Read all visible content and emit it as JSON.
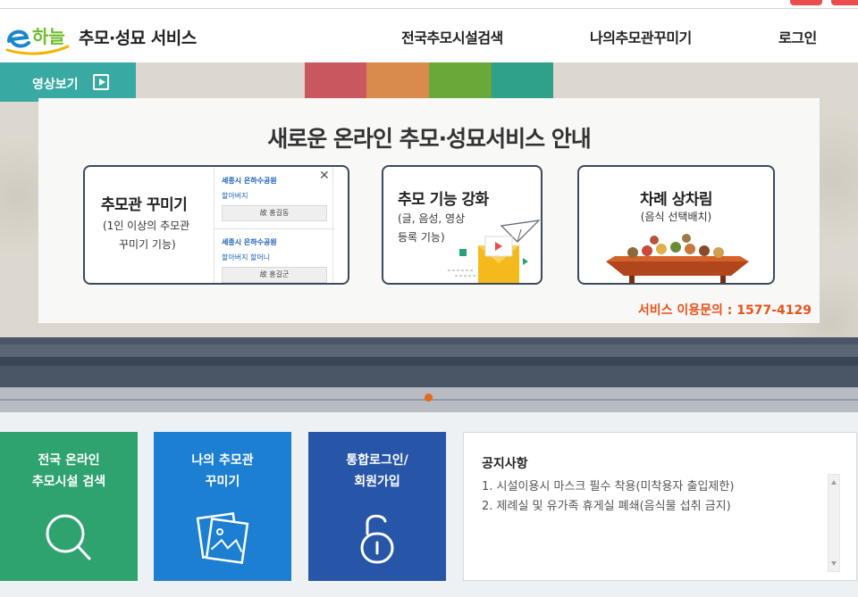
{
  "header": {
    "logo_text": "e하늘",
    "site_title": "추모·성묘 서비스",
    "nav": [
      "전국추모시설검색",
      "나의추모관꾸미기",
      "로그인"
    ]
  },
  "hero": {
    "video_button": "영상보기",
    "panel_title": "새로운 온라인 추모·성묘서비스 안내",
    "card1": {
      "title": "추모관 꾸미기",
      "desc_line1": "(1인 이상의 추모관",
      "desc_line2": "꾸미기 기능)",
      "mini_items": [
        {
          "place": "세종시 은하수공원",
          "relation": "할아버지",
          "name": "故 홍길동"
        },
        {
          "place": "세종시 은하수공원",
          "relation": "할아버지 할머니",
          "name": "故 홍길군"
        }
      ]
    },
    "card2": {
      "title": "추모 기능 강화",
      "desc_line1": "(글, 음성, 영상",
      "desc_line2": "등록 기능)"
    },
    "card3": {
      "title": "차례 상차림",
      "desc_line1": "(음식 선택배치)"
    },
    "contact": "서비스 이용문의 : 1577-4129"
  },
  "tiles": [
    {
      "line1": "전국 온라인",
      "line2": "추모시설 검색",
      "icon": "search-icon"
    },
    {
      "line1": "나의 추모관",
      "line2": "꾸미기",
      "icon": "photo-icon"
    },
    {
      "line1": "통합로그인/",
      "line2": "회원가입",
      "icon": "unlock-icon"
    }
  ],
  "notice": {
    "title": "공지사항",
    "items": [
      "1. 시설이용시 마스크 필수 착용(미착용자 출입제한)",
      "2. 제례실 및 유가족 휴게실 폐쇄(음식물 섭취 금지)"
    ]
  },
  "colors": {
    "teal": "#38a9a3",
    "green_tile": "#2fa36f",
    "blue_tile": "#1c7fd1",
    "navy_tile": "#2755a8",
    "accent_orange": "#e8531c"
  }
}
